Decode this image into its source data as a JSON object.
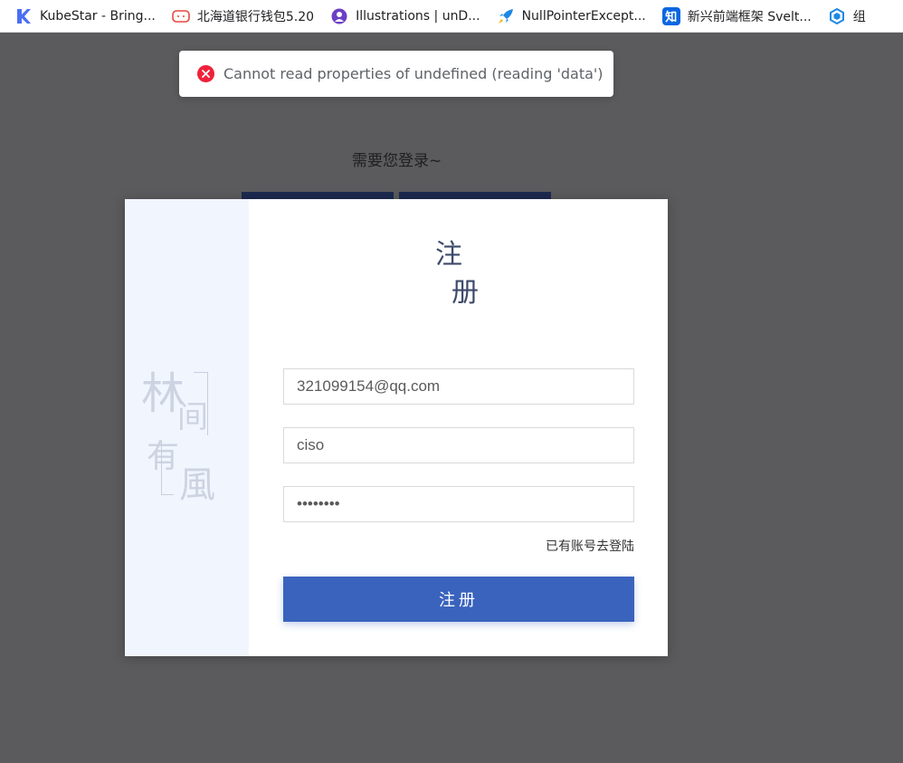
{
  "bookmarks": [
    {
      "label": "KubeStar - Bring...",
      "icon": "kubestar-icon",
      "color": "#4b6ef5"
    },
    {
      "label": "北海道银行钱包5.20",
      "icon": "wallet-icon",
      "color": "#e8453c"
    },
    {
      "label": "Illustrations | unD...",
      "icon": "undraw-icon",
      "color": "#6c3fc5"
    },
    {
      "label": "NullPointerExcept...",
      "icon": "rocket-icon",
      "color": "#1e88e5"
    },
    {
      "label": "新兴前端框架 Svelt...",
      "icon": "zhihu-icon",
      "color": "#0a66e0"
    },
    {
      "label": "组",
      "icon": "hex-icon",
      "color": "#1e88e5"
    }
  ],
  "zhihu_glyph": "知",
  "toast": {
    "message": "Cannot read properties of undefined (reading 'data')",
    "color": "#f0213a"
  },
  "background_page": {
    "need_login_text": "需要您登录~"
  },
  "register": {
    "title_char_1": "注",
    "title_char_2": "册",
    "seal_chars": [
      "林",
      "间",
      "有",
      "風"
    ],
    "email_value": "321099154@qq.com",
    "username_value": "ciso",
    "password_value": "••••••••",
    "goto_login_text": "已有账号去登陆",
    "submit_label": "注册",
    "accent_color": "#3a63bd"
  }
}
